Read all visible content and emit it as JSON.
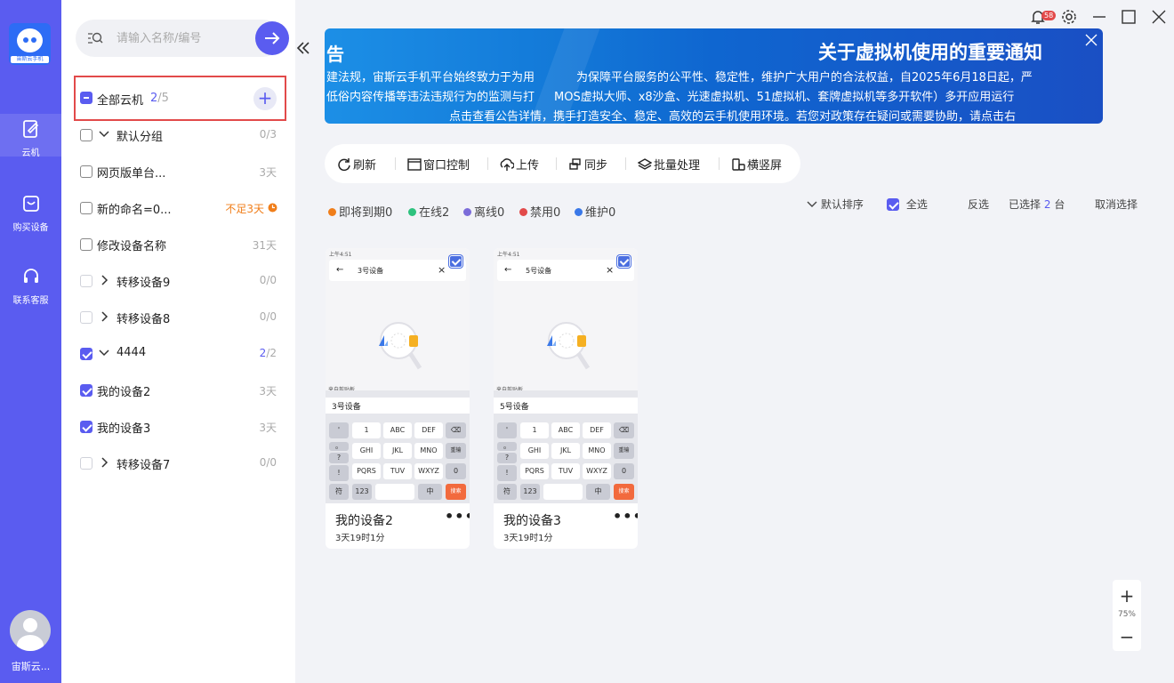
{
  "nav": {
    "logo_text": "宙斯云手机",
    "items": [
      {
        "label": "云机",
        "icon": "cloud-phone-icon"
      },
      {
        "label": "购买设备",
        "icon": "shopping-bag-icon"
      },
      {
        "label": "联系客服",
        "icon": "headset-icon"
      }
    ],
    "user_name": "宙斯云..."
  },
  "search": {
    "placeholder": "请输入名称/编号"
  },
  "groups": {
    "all": {
      "label": "全部云机",
      "selected": "2",
      "total": "/5"
    },
    "rows": [
      {
        "label": "默认分组",
        "count": "0/3"
      },
      {
        "label": "网页版单台...",
        "count": "3天"
      },
      {
        "label": "新的命名=0...",
        "count": "不足3天"
      },
      {
        "label": "修改设备名称",
        "count": "31天"
      },
      {
        "label": "转移设备9",
        "count": "0/0"
      },
      {
        "label": "转移设备8",
        "count": "0/0"
      },
      {
        "label": "4444",
        "count_a": "2",
        "count_b": "/2"
      },
      {
        "label": "我的设备2",
        "count": "3天"
      },
      {
        "label": "我的设备3",
        "count": "3天"
      },
      {
        "label": "转移设备7",
        "count": "0/0"
      }
    ]
  },
  "titlebar": {
    "badge": "58"
  },
  "banner": {
    "title": "关于虚拟机使用的重要通知",
    "left_title": "告",
    "left_line1": "建法规，宙斯云手机平台始终致力于为用",
    "left_line2": "低俗内容传播等违法违规行为的监测与打",
    "line1": "为保障平台服务的公平性、稳定性，维护广大用户的合法权益，自2025年6月18日起，严",
    "line2": "MOS虚拟大师、x8沙盒、光速虚拟机、51虚拟机、套牌虚拟机等多开软件）多开应用运行",
    "line3": "点击查看公告详情，携手打造安全、稳定、高效的云手机使用环境。若您对政策存在疑问或需要协助，请点击右"
  },
  "toolbar": {
    "refresh": "刷新",
    "window": "窗口控制",
    "upload": "上传",
    "sync": "同步",
    "batch": "批量处理",
    "orient": "横竖屏"
  },
  "status": {
    "expiring": "即将到期0",
    "online": "在线2",
    "offline": "离线0",
    "disabled": "禁用0",
    "maintenance": "维护0"
  },
  "controls": {
    "sort": "默认排序",
    "select_all": "全选",
    "invert": "反选",
    "selected_prefix": "已选择",
    "selected_count": "2",
    "selected_suffix": "台",
    "cancel": "取消选择"
  },
  "cards": [
    {
      "name": "我的设备2",
      "time": "3天19时1分",
      "statusbar": "上午4:51",
      "query": "3号设备",
      "clip_label": "来自剪贴板",
      "clip_text": "3号设备",
      "keys": [
        "'",
        "1",
        "ABC",
        "DEF",
        "⌫",
        "。",
        "GHI",
        "JKL",
        "MNO",
        "重输",
        "?",
        "!",
        "PQRS",
        "TUV",
        "WXYZ",
        "0",
        "符",
        "123",
        "中",
        "搜索"
      ]
    },
    {
      "name": "我的设备3",
      "time": "3天19时1分",
      "statusbar": "上午4:51",
      "query": "5号设备",
      "clip_label": "来自剪贴板",
      "clip_text": "5号设备",
      "keys": [
        "'",
        "1",
        "ABC",
        "DEF",
        "⌫",
        "。",
        "GHI",
        "JKL",
        "MNO",
        "重输",
        "?",
        "!",
        "PQRS",
        "TUV",
        "WXYZ",
        "0",
        "符",
        "123",
        "中",
        "搜索"
      ]
    }
  ],
  "zoom": {
    "level": "75%"
  },
  "colors": {
    "accent": "#5a5cf0",
    "warning": "#f07e1a",
    "banner": "#1379d8",
    "highlight_border": "#e24a4a"
  }
}
